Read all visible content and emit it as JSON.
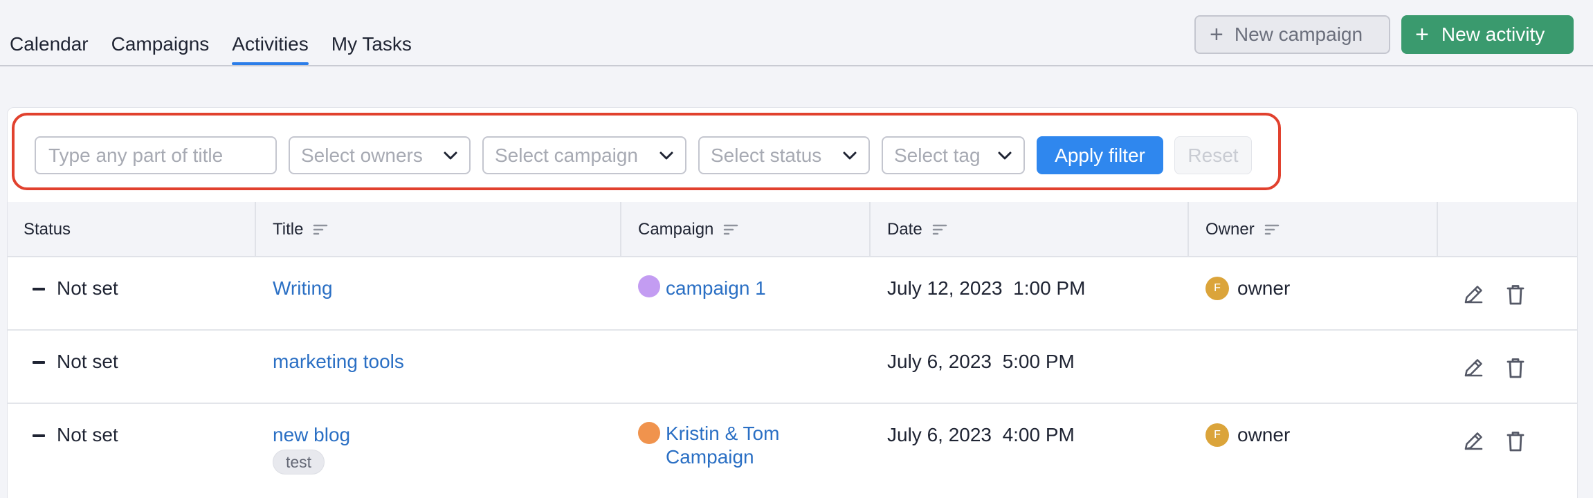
{
  "nav": {
    "tabs": [
      {
        "label": "Calendar",
        "active": false
      },
      {
        "label": "Campaigns",
        "active": false
      },
      {
        "label": "Activities",
        "active": true
      },
      {
        "label": "My Tasks",
        "active": false
      }
    ],
    "new_campaign_label": "New campaign",
    "new_activity_label": "New activity"
  },
  "filters": {
    "title_placeholder": "Type any part of title",
    "owners_placeholder": "Select owners",
    "campaign_placeholder": "Select campaign",
    "status_placeholder": "Select status",
    "tag_placeholder": "Select tag",
    "apply_label": "Apply filter",
    "reset_label": "Reset"
  },
  "table": {
    "columns": [
      "Status",
      "Title",
      "Campaign",
      "Date",
      "Owner"
    ],
    "rows": [
      {
        "status": "Not set",
        "title": "Writing",
        "campaign_line1": "campaign 1",
        "campaign_line2": "",
        "campaign_color": "#c39cf2",
        "date": "July 12, 2023",
        "time": "1:00 PM",
        "owner_initial": "F",
        "owner": "owner",
        "tag": ""
      },
      {
        "status": "Not set",
        "title": "marketing tools",
        "campaign_line1": "",
        "campaign_line2": "",
        "campaign_color": "",
        "date": "July 6, 2023",
        "time": "5:00 PM",
        "owner_initial": "",
        "owner": "",
        "tag": ""
      },
      {
        "status": "Not set",
        "title": "new blog",
        "campaign_line1": "Kristin & Tom",
        "campaign_line2": "Campaign",
        "campaign_color": "#f0934d",
        "date": "July 6, 2023",
        "time": "4:00 PM",
        "owner_initial": "F",
        "owner": "owner",
        "tag": "test"
      }
    ]
  },
  "colors": {
    "accent_blue": "#2f87ee",
    "brand_green": "#3a9a6e",
    "highlight_red": "#e1412e",
    "link_blue": "#2a6fc4",
    "owner_avatar": "#dba43a"
  }
}
